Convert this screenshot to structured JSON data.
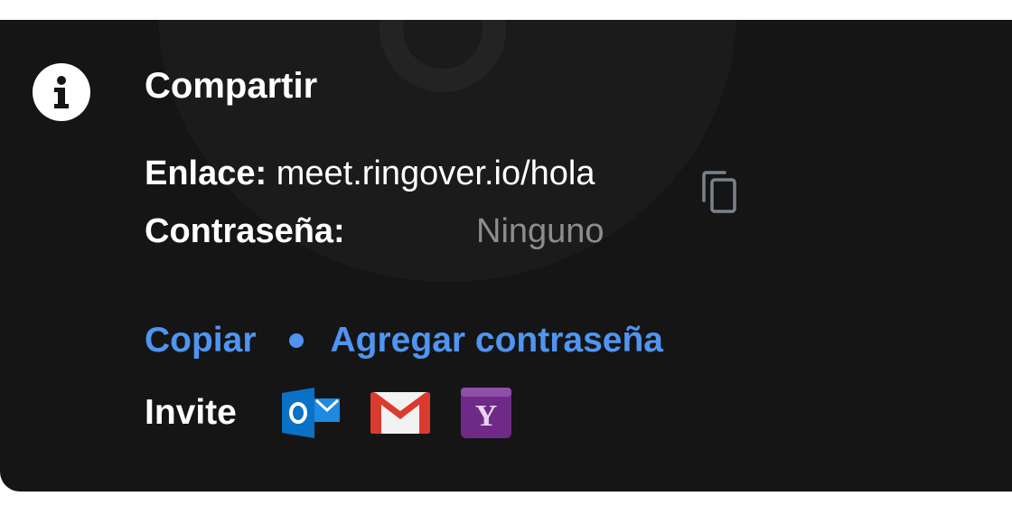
{
  "share": {
    "title": "Compartir",
    "link_label": "Enlace:",
    "link_value": "meet.ringover.io/hola",
    "password_label": "Contraseña:",
    "password_value": "Ninguno",
    "copy_action": "Copiar",
    "add_password_action": "Agregar contraseña",
    "invite_label": "Invite",
    "invite_services": [
      "outlook-icon",
      "gmail-icon",
      "yahoo-icon"
    ]
  },
  "colors": {
    "panel_bg": "#151516",
    "link_blue": "#4f95f2",
    "muted_text": "#8d8d8f"
  }
}
